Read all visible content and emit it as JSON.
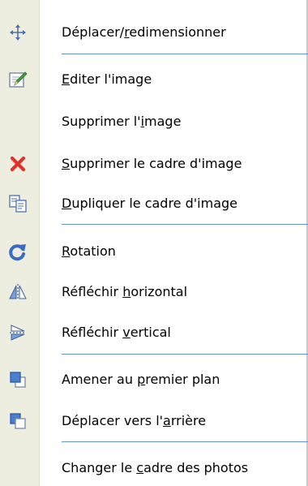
{
  "menu": {
    "items": [
      {
        "pre": "Déplacer/",
        "ul": "r",
        "post": "edimensionner",
        "icon": "move-arrows-icon"
      },
      {
        "pre": "",
        "ul": "E",
        "post": "diter l'image",
        "icon": "edit-image-icon"
      },
      {
        "pre": "Supprimer l'",
        "ul": "i",
        "post": "mage",
        "icon": ""
      },
      {
        "pre": "",
        "ul": "S",
        "post": "upprimer le cadre d'image",
        "icon": "delete-x-icon"
      },
      {
        "pre": "",
        "ul": "D",
        "post": "upliquer le cadre d'image",
        "icon": "duplicate-icon"
      },
      {
        "pre": "",
        "ul": "R",
        "post": "otation",
        "icon": "rotate-icon"
      },
      {
        "pre": "Réfléchir ",
        "ul": "h",
        "post": "orizontal",
        "icon": "flip-horizontal-icon"
      },
      {
        "pre": "Réfléchir ",
        "ul": "v",
        "post": "ertical",
        "icon": "flip-vertical-icon"
      },
      {
        "pre": "Amener au ",
        "ul": "p",
        "post": "remier plan",
        "icon": "bring-to-front-icon"
      },
      {
        "pre": "Déplacer vers l'",
        "ul": "a",
        "post": "rrière",
        "icon": "send-backward-icon"
      },
      {
        "pre": "Changer le ",
        "ul": "c",
        "post": "adre des photos",
        "icon": ""
      }
    ],
    "colors": {
      "gutter": "#eeeee0",
      "separator": "#6b8ed6",
      "delete": "#e0322a"
    }
  }
}
